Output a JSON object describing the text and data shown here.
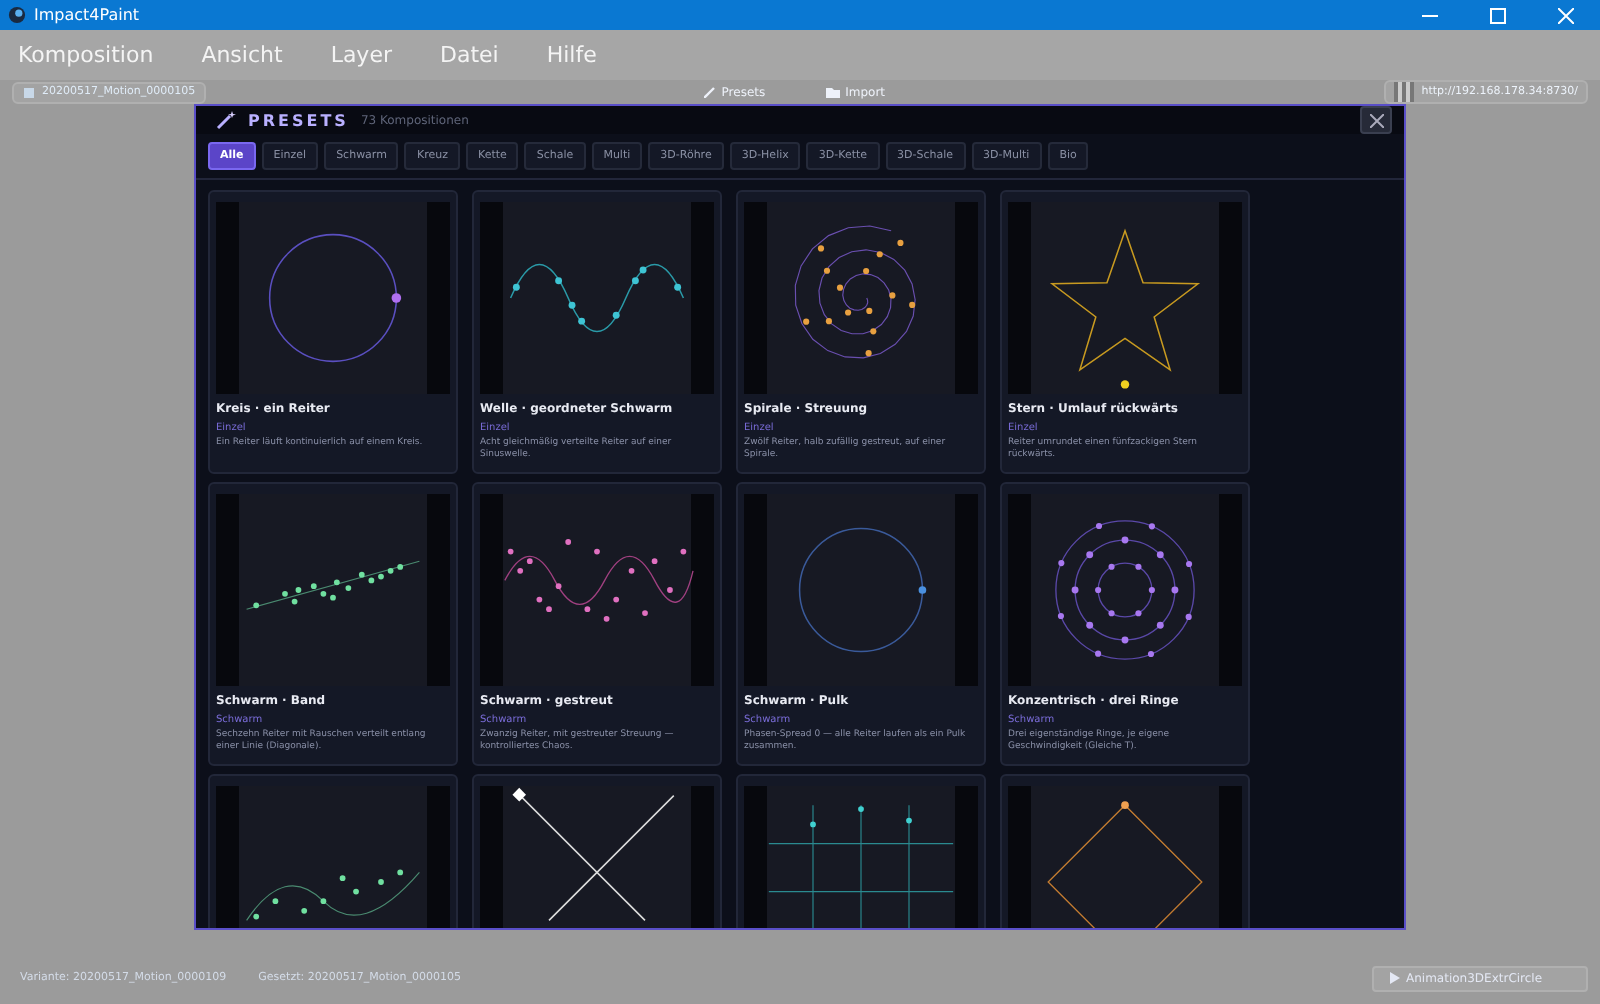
{
  "window": {
    "title": "Impact4Paint"
  },
  "menu": [
    "Komposition",
    "Ansicht",
    "Layer",
    "Datei",
    "Hilfe"
  ],
  "toolbar": {
    "composition": "20200517_Motion_0000105",
    "actions": [
      {
        "label": "Presets",
        "kind": "presets"
      },
      {
        "label": "Import",
        "kind": "import"
      }
    ],
    "url": "http://192.168.178.34:8730/"
  },
  "presets": {
    "title": "PRESETS",
    "count": "73 Kompositionen",
    "filters": [
      {
        "label": "Alle",
        "selected": true
      },
      {
        "label": "Einzel",
        "selected": false
      },
      {
        "label": "Schwarm",
        "selected": false
      },
      {
        "label": "Kreuz",
        "selected": false
      },
      {
        "label": "Kette",
        "selected": false
      },
      {
        "label": "Schale",
        "selected": false
      },
      {
        "label": "Multi",
        "selected": false
      },
      {
        "label": "3D-Röhre",
        "selected": false
      },
      {
        "label": "3D-Helix",
        "selected": false
      },
      {
        "label": "3D-Kette",
        "selected": false
      },
      {
        "label": "3D-Schale",
        "selected": false
      },
      {
        "label": "3D-Multi",
        "selected": false
      },
      {
        "label": "Bio",
        "selected": false
      }
    ],
    "cards": [
      {
        "kind": "circle",
        "title": "Kreis · ein Reiter",
        "category": "Einzel",
        "description": "Ein Reiter läuft kontinuierlich auf einem Kreis."
      },
      {
        "kind": "wave",
        "title": "Welle · geordneter Schwarm",
        "category": "Einzel",
        "description": "Acht gleichmäßig verteilte Reiter auf einer Sinuswelle."
      },
      {
        "kind": "spiral",
        "title": "Spirale · Streuung",
        "category": "Einzel",
        "description": "Zwölf Reiter, halb zufällig gestreut, auf einer Spirale."
      },
      {
        "kind": "star",
        "title": "Stern · Umlauf rückwärts",
        "category": "Einzel",
        "description": "Reiter umrundet einen fünfzackigen Stern rückwärts."
      },
      {
        "kind": "band",
        "title": "Schwarm · Band",
        "category": "Schwarm",
        "description": "Sechzehn Reiter mit Rauschen verteilt entlang einer Linie (Diagonale)."
      },
      {
        "kind": "scatter",
        "title": "Schwarm · gestreut",
        "category": "Schwarm",
        "description": "Zwanzig Reiter, mit gestreuter Streuung — kontrolliertes Chaos."
      },
      {
        "kind": "pulk",
        "title": "Schwarm · Pulk",
        "category": "Schwarm",
        "description": "Phasen-Spread 0 — alle Reiter laufen als ein Pulk zusammen."
      },
      {
        "kind": "rings",
        "title": "Konzentrisch · drei Ringe",
        "category": "Schwarm",
        "description": "Drei eigenständige Ringe, je eigene Geschwindigkeit (Gleiche T)."
      },
      {
        "kind": "wave2"
      },
      {
        "kind": "cross"
      },
      {
        "kind": "grid"
      },
      {
        "kind": "diamond"
      }
    ]
  },
  "status": {
    "variant": "Variante: 20200517_Motion_0000109",
    "set": "Gesetzt: 20200517_Motion_0000105",
    "play": "Animation3DExtrCircle"
  }
}
